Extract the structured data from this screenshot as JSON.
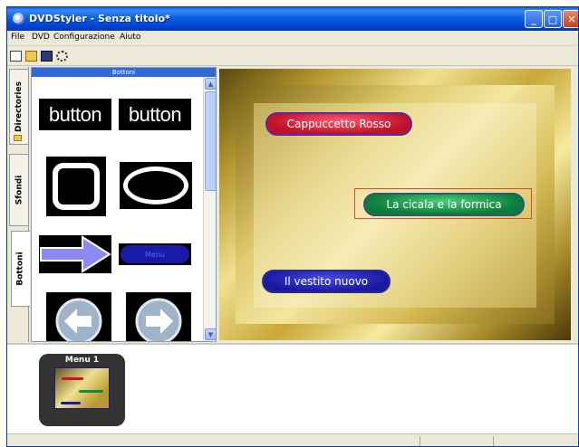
{
  "window": {
    "title": "DVDStyler - Senza titolo*"
  },
  "window_controls": {
    "minimize": "_",
    "maximize": "□",
    "close": "✕"
  },
  "menubar": {
    "items": [
      "File",
      "DVD",
      "Configurazione",
      "Aiuto"
    ]
  },
  "toolbar": {
    "icons": [
      "new-file-icon",
      "open-folder-icon",
      "save-icon",
      "settings-icon"
    ]
  },
  "sidebar": {
    "tabs": [
      {
        "label": "Directories"
      },
      {
        "label": "Sfondi"
      },
      {
        "label": "Bottoni",
        "active": true
      }
    ]
  },
  "button_panel": {
    "header": "Bottoni",
    "items": [
      {
        "label": "button"
      },
      {
        "label": "button"
      },
      {
        "label": ""
      },
      {
        "label": ""
      },
      {
        "label": ""
      },
      {
        "label": "Menu"
      },
      {
        "label": ""
      },
      {
        "label": ""
      }
    ]
  },
  "menu_canvas": {
    "buttons": [
      {
        "label": "Cappuccetto Rosso",
        "color": "#c0102a"
      },
      {
        "label": "La cicala e la formica",
        "color": "#0e7a3c",
        "selected": true
      },
      {
        "label": "Il vestito nuovo",
        "color": "#1a1aa0"
      }
    ]
  },
  "titleset": {
    "menus": [
      {
        "label": "Menu 1"
      }
    ]
  },
  "colors": {
    "titlebar": "#0a5fe0",
    "panel_header": "#3168d5",
    "selection": "#e04a2a"
  }
}
